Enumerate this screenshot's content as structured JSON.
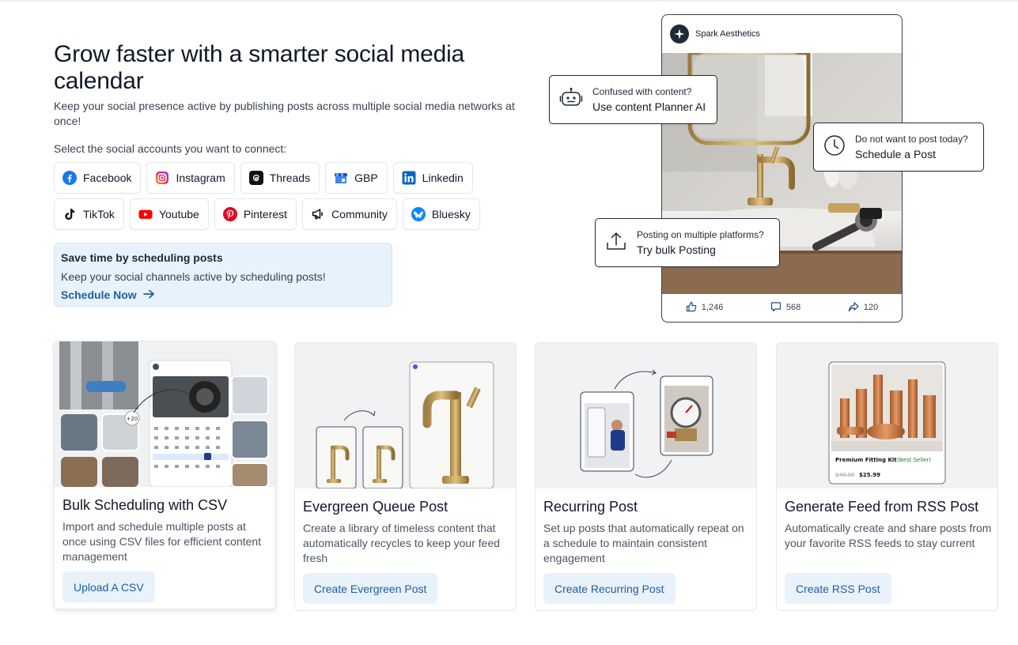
{
  "hero": {
    "title": "Grow faster with a smarter social media calendar",
    "subtitle": "Keep your social presence active by publishing posts across multiple social media networks at once!",
    "select_label": "Select the social accounts you want to connect:"
  },
  "accounts": [
    {
      "label": "Facebook",
      "icon": "facebook-icon"
    },
    {
      "label": "Instagram",
      "icon": "instagram-icon"
    },
    {
      "label": "Threads",
      "icon": "threads-icon"
    },
    {
      "label": "GBP",
      "icon": "gbp-icon"
    },
    {
      "label": "Linkedin",
      "icon": "linkedin-icon"
    },
    {
      "label": "TikTok",
      "icon": "tiktok-icon"
    },
    {
      "label": "Youtube",
      "icon": "youtube-icon"
    },
    {
      "label": "Pinterest",
      "icon": "pinterest-icon"
    },
    {
      "label": "Community",
      "icon": "community-icon"
    },
    {
      "label": "Bluesky",
      "icon": "bluesky-icon"
    }
  ],
  "promo": {
    "title": "Save time by scheduling posts",
    "text": "Keep your social channels active by scheduling posts!",
    "link": "Schedule Now"
  },
  "preview": {
    "brand": "Spark Aesthetics",
    "likes": "1,246",
    "comments": "568",
    "shares": "120"
  },
  "bubbles": {
    "planner": {
      "small": "Confused with content?",
      "big": "Use content Planner AI"
    },
    "schedule": {
      "small": "Do not want to post today?",
      "big": "Schedule a Post"
    },
    "bulk": {
      "small": "Posting on multiple platforms?",
      "big": "Try bulk Posting"
    }
  },
  "cards": [
    {
      "title": "Bulk Scheduling with CSV",
      "desc": "Import and schedule multiple posts at once using CSV files for efficient content management",
      "button": "Upload A CSV"
    },
    {
      "title": "Evergreen Queue Post",
      "desc": "Create a library of timeless content that automatically recycles to keep your feed fresh",
      "button": "Create Evergreen Post"
    },
    {
      "title": "Recurring Post",
      "desc": "Set up posts that automatically repeat on a schedule to maintain consistent engagement",
      "button": "Create Recurring Post"
    },
    {
      "title": "Generate Feed from RSS Post",
      "desc": "Automatically create and share posts from your favorite RSS feeds to stay current",
      "button": "Create RSS Post"
    }
  ],
  "card_art": {
    "bulk_badge": "+20",
    "rss_product": "Premium Fitting Kit",
    "rss_badge": "(Best Seller)",
    "rss_old_price": "$49.00",
    "rss_price": "$25.99"
  },
  "colors": {
    "accent": "#1d5fa0",
    "promo_bg": "#e8f2fc",
    "button_bg": "#e9f1fb"
  }
}
